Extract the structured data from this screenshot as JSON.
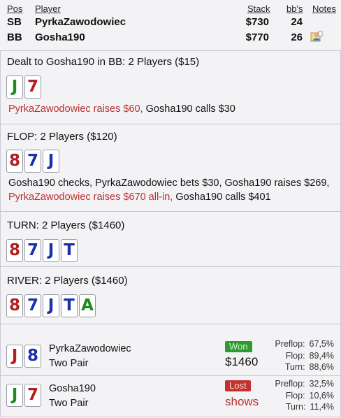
{
  "table": {
    "headers": {
      "pos": "Pos",
      "player": "Player",
      "stack": "Stack",
      "bbs": "bb's",
      "notes": "Notes"
    },
    "rows": [
      {
        "pos": "SB",
        "player": "PyrkaZawodowiec",
        "stack": "$730",
        "bbs": "24"
      },
      {
        "pos": "BB",
        "player": "Gosha190",
        "stack": "$770",
        "bbs": "26",
        "note_icon": "person-note-icon"
      }
    ]
  },
  "preflop": {
    "title": "Dealt to Gosha190 in BB: 2 Players ($15)",
    "cards": [
      {
        "rank": "J",
        "color": "#1f8a1f"
      },
      {
        "rank": "7",
        "color": "#b01e1e"
      }
    ],
    "actions": [
      {
        "text": "PyrkaZawodowiec raises $60, ",
        "color": "red"
      },
      {
        "text": "Gosha190 calls $30",
        "color": "normal"
      }
    ]
  },
  "flop": {
    "title": "FLOP: 2 Players ($120)",
    "cards": [
      {
        "rank": "8",
        "color": "#b01e1e"
      },
      {
        "rank": "7",
        "color": "#1c2fa8"
      },
      {
        "rank": "J",
        "color": "#1c2fa8"
      }
    ],
    "actions_line1": "Gosha190 checks, PyrkaZawodowiec bets $30, Gosha190 raises $269,",
    "actions_line2_red": "PyrkaZawodowiec raises $670 all-in, ",
    "actions_line2_normal": "Gosha190 calls $401"
  },
  "turn": {
    "title": "TURN: 2 Players ($1460)",
    "cards": [
      {
        "rank": "8",
        "color": "#b01e1e"
      },
      {
        "rank": "7",
        "color": "#1c2fa8"
      },
      {
        "rank": "J",
        "color": "#1c2fa8"
      },
      {
        "rank": "T",
        "color": "#1c2fa8"
      }
    ]
  },
  "river": {
    "title": "RIVER: 2 Players ($1460)",
    "cards": [
      {
        "rank": "8",
        "color": "#b01e1e"
      },
      {
        "rank": "7",
        "color": "#1c2fa8"
      },
      {
        "rank": "J",
        "color": "#1c2fa8"
      },
      {
        "rank": "T",
        "color": "#1c2fa8"
      },
      {
        "rank": "A",
        "color": "#1f8a1f"
      }
    ]
  },
  "results": [
    {
      "cards": [
        {
          "rank": "J",
          "color": "#b01e1e"
        },
        {
          "rank": "8",
          "color": "#1c2fa8"
        }
      ],
      "player": "PyrkaZawodowiec",
      "hand": "Two Pair",
      "badge": "Won",
      "amount": "$1460",
      "equity": [
        {
          "label": "Preflop:",
          "value": "67,5%"
        },
        {
          "label": "Flop:",
          "value": "89,4%"
        },
        {
          "label": "Turn:",
          "value": "88,6%"
        }
      ]
    },
    {
      "cards": [
        {
          "rank": "J",
          "color": "#1f8a1f"
        },
        {
          "rank": "7",
          "color": "#b01e1e"
        }
      ],
      "player": "Gosha190",
      "hand": "Two Pair",
      "badge": "Lost",
      "amount": "shows",
      "equity": [
        {
          "label": "Preflop:",
          "value": "32,5%"
        },
        {
          "label": "Flop:",
          "value": "10,6%"
        },
        {
          "label": "Turn:",
          "value": "11,4%"
        }
      ]
    }
  ]
}
